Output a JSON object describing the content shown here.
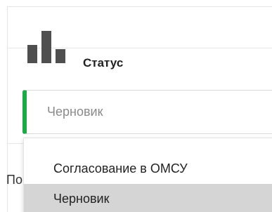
{
  "field": {
    "label": "Статус",
    "icon": "bar-chart-icon",
    "accent_color": "#1aab48",
    "selected_value": "Черновик"
  },
  "background": {
    "partial_label": "По"
  },
  "dropdown": {
    "options": [
      {
        "label": "Согласование в ОМСУ",
        "highlighted": false
      },
      {
        "label": "Черновик",
        "highlighted": true
      }
    ]
  }
}
